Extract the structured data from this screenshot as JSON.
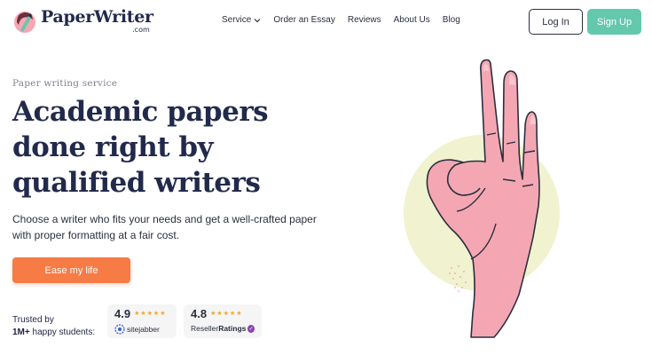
{
  "header": {
    "logo_name": "PaperWriter",
    "logo_com": ".com",
    "nav": [
      {
        "label": "Service",
        "has_dropdown": true
      },
      {
        "label": "Order an Essay",
        "has_dropdown": false
      },
      {
        "label": "Reviews",
        "has_dropdown": false
      },
      {
        "label": "About Us",
        "has_dropdown": false
      },
      {
        "label": "Blog",
        "has_dropdown": false
      }
    ],
    "login_label": "Log In",
    "signup_label": "Sign Up"
  },
  "hero": {
    "eyebrow": "Paper writing service",
    "headline": "Academic papers done right by qualified writers",
    "subtext": "Choose a writer who fits your needs and get a well-crafted paper with proper formatting at a fair cost.",
    "cta_label": "Ease my life",
    "trusted_line1": "Trusted by",
    "trusted_line2_bold": "1M+",
    "trusted_line2_rest": " happy students:",
    "ratings": [
      {
        "score": "4.9",
        "stars": 5,
        "brand": "sitejabber",
        "brand_icon": "sitejabber-icon"
      },
      {
        "score": "4.8",
        "stars": 5,
        "brand_prefix": "Reseller",
        "brand_bold": "Ratings",
        "brand_icon": "verified-badge-icon"
      }
    ]
  },
  "colors": {
    "brand_navy": "#222a4b",
    "signup_green": "#64c8ad",
    "cta_orange": "#f67b45",
    "hand_pink": "#f4a7b3",
    "circle_yellow": "#f1f2cf",
    "star": "#f5a623"
  }
}
